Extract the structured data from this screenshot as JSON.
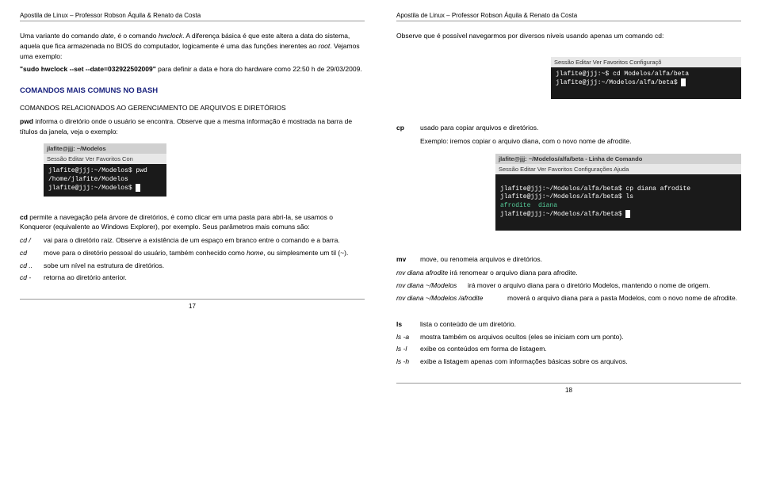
{
  "header": "Apostila de Linux – Professor Robson Áquila & Renato da Costa",
  "left": {
    "p1_1": "Uma variante do comando ",
    "p1_date": "date",
    "p1_2": ", é o comando ",
    "p1_hwclock": "hwclock",
    "p1_3": ". A diferença básica é que este altera a data do sistema, aquela que fica armazenada no BIOS do computador, logicamente é uma das funções inerentes ao ",
    "p1_root": "root",
    "p1_4": ". Vejamos uma exemplo:",
    "p2_1": "\"sudo hwclock --set --date=032922502009\"",
    "p2_2": " para definir a data e hora do hardware como 22:50 h de 29/03/2009.",
    "h1": "COMANDOS MAIS COMUNS NO BASH",
    "p3": "COMANDOS RELACIONADOS AO GERENCIAMENTO DE ARQUIVOS E DIRETÓRIOS",
    "p4_pwd": "pwd",
    "p4_1": "   informa o diretório onde o usuário se encontra. Observe que a mesma informação é mostrada na barra de títulos da janela, veja o exemplo:",
    "term1_title": "jlafite@jjj: ~/Modelos",
    "term_menu": "Sessão   Editar   Ver    Favoritos   Con",
    "term1_line1": "jlafite@jjj:~/Modelos$ pwd",
    "term1_line2": "/home/jlafite/Modelos",
    "term1_line3": "jlafite@jjj:~/Modelos$ ",
    "p5_cd": "cd",
    "p5_1": "      permite a navegação pela árvore de diretórios, é como clicar em uma pasta para abri-la, se usamos o Konqueror (equivalente ao Windows Explorer), por exemplo. Seus parâmetros mais comuns são:",
    "cd_slash_cmd": "cd  /",
    "cd_slash": "vai para o diretório raiz. Observe a existência de um espaço em branco entre o comando e a barra.",
    "cd_cmd": "cd",
    "cd_home_1": "move para o diretório pessoal do usuário, também conhecido como ",
    "cd_home_2": "home",
    "cd_home_3": ", ou simplesmente um til (~).",
    "cd_dot_cmd": "cd ..",
    "cd_dot": "sobe um nível na estrutura de diretórios.",
    "cd_dash_cmd": "cd -",
    "cd_dash": "retorna ao diretório anterior.",
    "pagenum": "17"
  },
  "right": {
    "p1": "Observe que é possível navegarmos por diversos níveis usando apenas um comando cd:",
    "term2_menu": " Sessão    Editar   Ver    Favoritos    Configuraçõ",
    "term2_line1": "jlafite@jjj:~$ cd Modelos/alfa/beta",
    "term2_line2": "jlafite@jjj:~/Modelos/alfa/beta$ ",
    "cp_cmd": "cp",
    "cp_desc": "usado para copiar arquivos e diretórios.",
    "cp_ex": "Exemplo: iremos copiar o arquivo diana, com o novo nome de afrodite.",
    "term3_title": "jlafite@jjj: ~/Modelos/alfa/beta - Linha de Comando",
    "term3_menu": " Sessão   Editar   Ver    Favoritos   Configurações   Ajuda",
    "term3_line1": "jlafite@jjj:~/Modelos/alfa/beta$ cp diana afrodite",
    "term3_line2": "jlafite@jjj:~/Modelos/alfa/beta$ ls",
    "term3_line3": "afrodite  diana",
    "term3_line4": "jlafite@jjj:~/Modelos/alfa/beta$ ",
    "mv_cmd": "mv",
    "mv_desc": "move, ou renomeia arquivos e diretórios.",
    "mv1_cmd": "mv diana afrodite",
    "mv1_desc": "   irá renomear o arquivo diana para afrodite.",
    "mv2_cmd": "mv diana ~/Modelos",
    "mv2_desc": "irá mover o arquivo diana para o diretório Modelos, mantendo o nome de origem.",
    "mv3_cmd": "mv diana ~/Modelos /afrodite",
    "mv3_desc": "moverá o arquivo diana para a pasta Modelos, com o novo nome de afrodite.",
    "ls_cmd": "ls",
    "ls_desc": "lista o conteúdo de um diretório.",
    "lsa_cmd": "ls -a",
    "lsa_desc": "mostra também os arquivos ocultos (eles se iniciam com um ponto).",
    "lsl_cmd": "ls -l",
    "lsl_desc": "exibe os conteúdos em forma de listagem.",
    "lsh_cmd": "ls -h",
    "lsh_desc": "exibe a listagem apenas com informações básicas sobre os arquivos.",
    "pagenum": "18"
  }
}
